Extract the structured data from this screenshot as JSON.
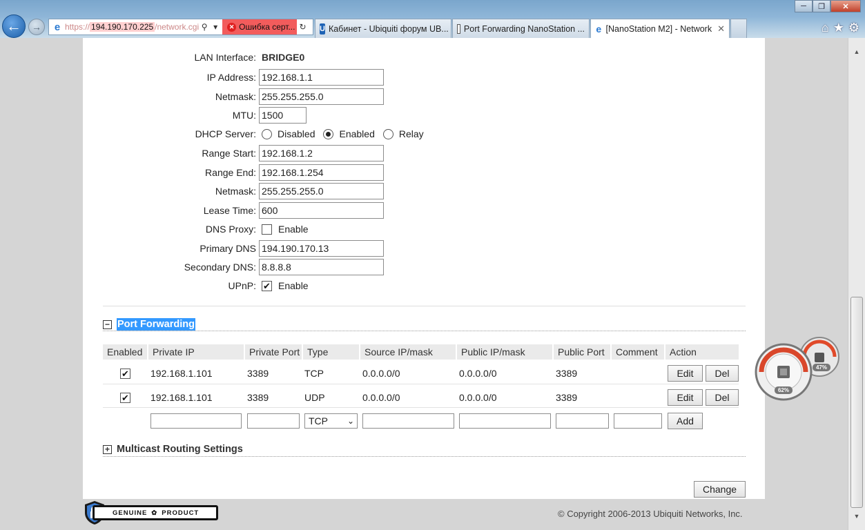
{
  "browser": {
    "address": {
      "scheme": "https://",
      "host": "194.190.170.225",
      "path": "/network.cgi",
      "cert_error": "Ошибка серт..."
    },
    "tabs": [
      {
        "label": "Кабинет - Ubiquiti форум UB...",
        "favicon": "ubiquiti-icon"
      },
      {
        "label": "Port Forwarding NanoStation ...",
        "favicon": "page-icon"
      },
      {
        "label": "[NanoStation M2] - Network",
        "favicon": "ie-icon",
        "active": true
      }
    ]
  },
  "lan": {
    "interface_label": "LAN Interface:",
    "interface_value": "BRIDGE0",
    "ip_label": "IP Address:",
    "ip_value": "192.168.1.1",
    "netmask_label": "Netmask:",
    "netmask_value": "255.255.255.0",
    "mtu_label": "MTU:",
    "mtu_value": "1500",
    "dhcp_label": "DHCP Server:",
    "dhcp_options": [
      "Disabled",
      "Enabled",
      "Relay"
    ],
    "dhcp_selected": "Enabled",
    "range_start_label": "Range Start:",
    "range_start_value": "192.168.1.2",
    "range_end_label": "Range End:",
    "range_end_value": "192.168.1.254",
    "dhcp_netmask_label": "Netmask:",
    "dhcp_netmask_value": "255.255.255.0",
    "lease_label": "Lease Time:",
    "lease_value": "600",
    "dns_proxy_label": "DNS Proxy:",
    "dns_proxy_option": "Enable",
    "dns_proxy_checked": false,
    "primary_dns_label": "Primary DNS",
    "primary_dns_value": "194.190.170.13",
    "secondary_dns_label": "Secondary DNS:",
    "secondary_dns_value": "8.8.8.8",
    "upnp_label": "UPnP:",
    "upnp_option": "Enable",
    "upnp_checked": true
  },
  "port_forwarding": {
    "title": "Port Forwarding",
    "columns": [
      "Enabled",
      "Private IP",
      "Private Port",
      "Type",
      "Source IP/mask",
      "Public IP/mask",
      "Public Port",
      "Comment",
      "Action"
    ],
    "rows": [
      {
        "enabled": true,
        "private_ip": "192.168.1.101",
        "private_port": "3389",
        "type": "TCP",
        "source": "0.0.0.0/0",
        "public": "0.0.0.0/0",
        "public_port": "3389",
        "comment": ""
      },
      {
        "enabled": true,
        "private_ip": "192.168.1.101",
        "private_port": "3389",
        "type": "UDP",
        "source": "0.0.0.0/0",
        "public": "0.0.0.0/0",
        "public_port": "3389",
        "comment": ""
      }
    ],
    "edit_label": "Edit",
    "del_label": "Del",
    "new_type": "TCP",
    "add_label": "Add"
  },
  "multicast": {
    "title": "Multicast Routing Settings"
  },
  "change_label": "Change",
  "footer": {
    "copyright": "© Copyright 2006-2013 Ubiquiti Networks, Inc.",
    "badge_left": "GENUINE",
    "badge_right": "PRODUCT"
  },
  "gadget": {
    "cpu": "62%",
    "ram": "47%"
  }
}
